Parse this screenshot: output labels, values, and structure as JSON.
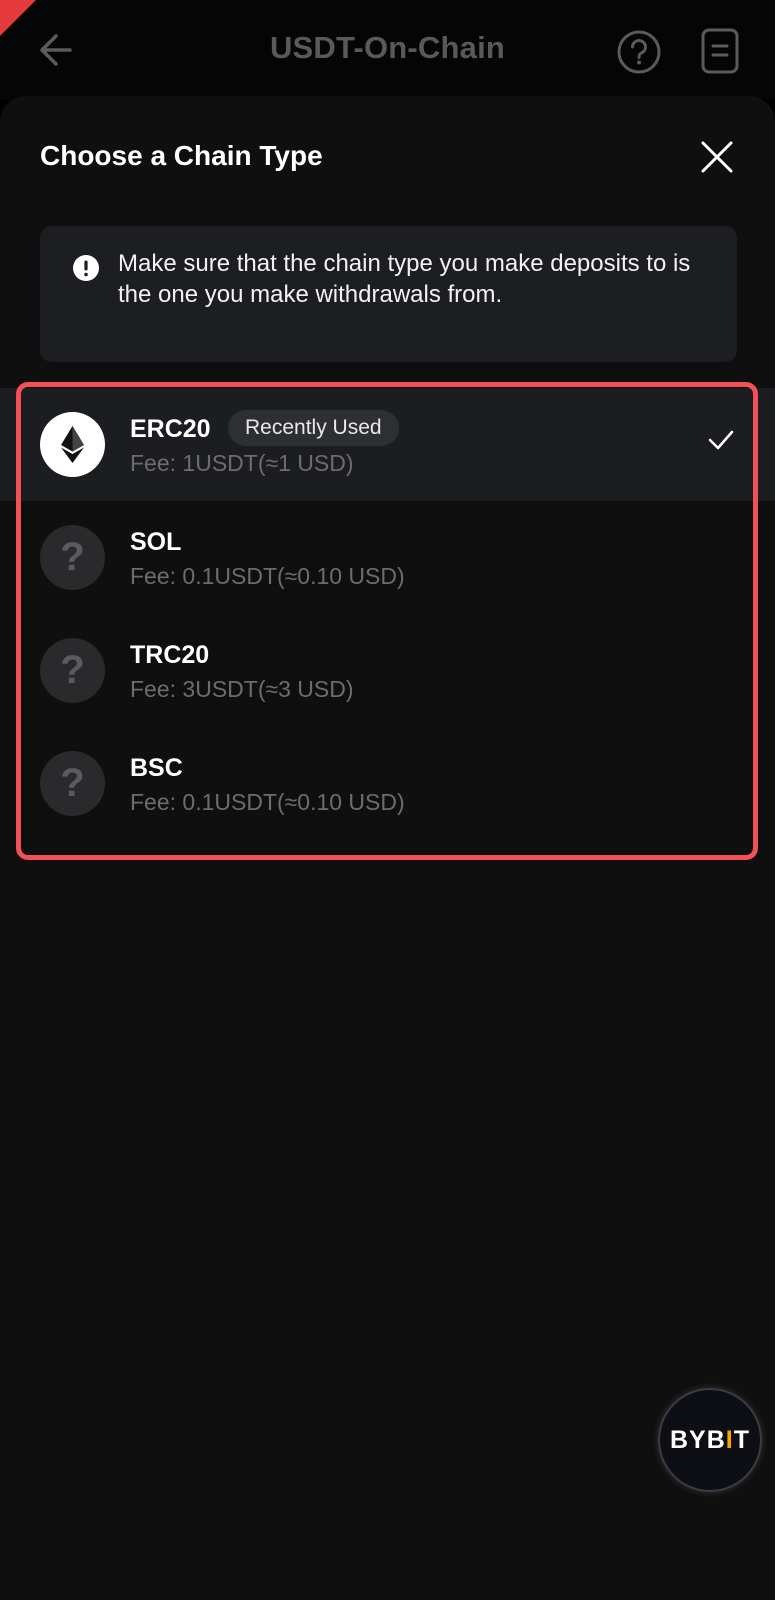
{
  "app_bar": {
    "title": "USDT-On-Chain"
  },
  "sheet": {
    "title": "Choose a Chain Type",
    "notice": "Make sure that the chain type you make deposits to is the one you make withdrawals from."
  },
  "chains": [
    {
      "name": "ERC20",
      "badge": "Recently Used",
      "fee": "Fee: 1USDT(≈1 USD)",
      "selected": true,
      "icon": "ethereum-icon"
    },
    {
      "name": "SOL",
      "fee": "Fee: 0.1USDT(≈0.10 USD)",
      "selected": false,
      "icon": "unknown-token-icon"
    },
    {
      "name": "TRC20",
      "fee": "Fee: 3USDT(≈3 USD)",
      "selected": false,
      "icon": "unknown-token-icon"
    },
    {
      "name": "BSC",
      "fee": "Fee: 0.1USDT(≈0.10 USD)",
      "selected": false,
      "icon": "unknown-token-icon"
    }
  ],
  "unknown_icon_glyph": "?",
  "watermark": {
    "text_a": "BYB",
    "text_b": "I",
    "text_c": "T"
  },
  "colors": {
    "highlight": "#f25157",
    "accent": "#f7a600",
    "background": "#0f0f10"
  }
}
